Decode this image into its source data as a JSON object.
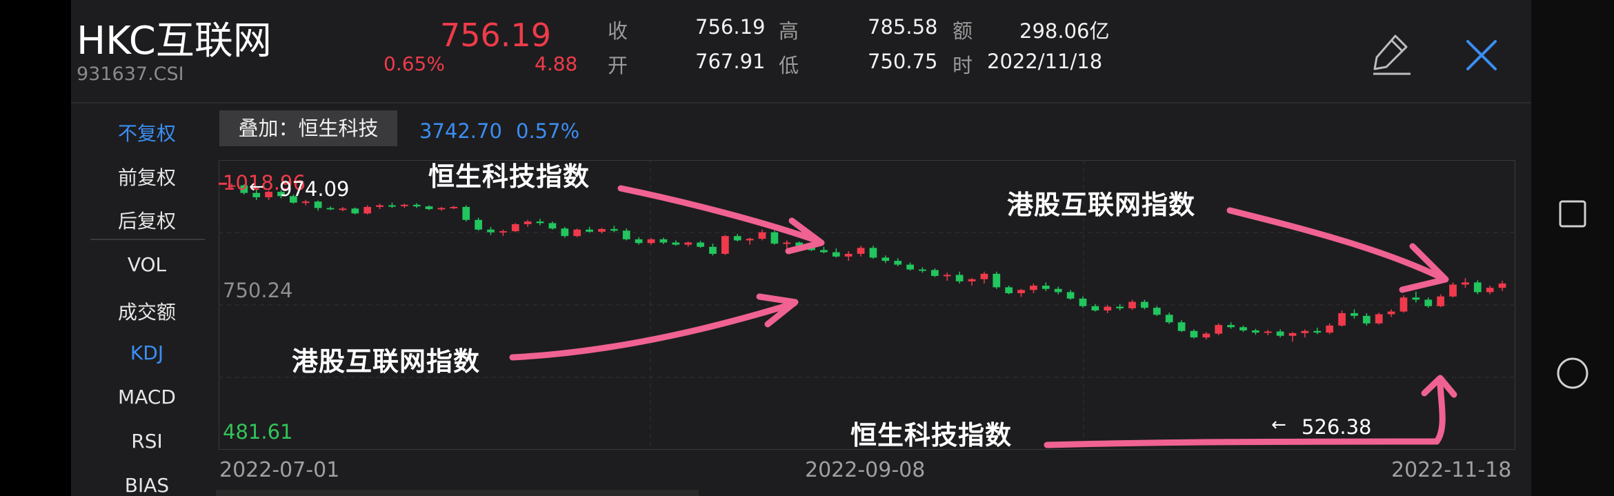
{
  "header": {
    "title": "HKC互联网",
    "code": "931637.CSI",
    "price": "756.19",
    "change_pct": "0.65%",
    "change": "4.88",
    "stats": [
      {
        "label": "收",
        "value": "756.19"
      },
      {
        "label": "开",
        "value": "767.91"
      },
      {
        "label": "高",
        "value": "785.58"
      },
      {
        "label": "低",
        "value": "750.75"
      },
      {
        "label": "额",
        "value": "298.06亿"
      },
      {
        "label": "时",
        "value": "2022/11/18"
      }
    ],
    "edit_icon": "pencil-icon",
    "close_icon": "close-icon"
  },
  "sidebar": {
    "items": [
      {
        "label": "不复权",
        "active": true
      },
      {
        "label": "前复权",
        "active": false
      },
      {
        "label": "后复权",
        "active": false
      },
      {
        "label": "VOL",
        "active": false
      },
      {
        "label": "成交额",
        "active": false
      },
      {
        "label": "KDJ",
        "active": true
      },
      {
        "label": "MACD",
        "active": false
      },
      {
        "label": "RSI",
        "active": false
      },
      {
        "label": "BIAS",
        "active": false
      }
    ]
  },
  "overlay": {
    "label": "叠加：恒生科技",
    "value": "3742.70",
    "pct": "0.57%"
  },
  "chart_data": {
    "type": "candlestick",
    "x_tick_labels": [
      "2022-07-01",
      "2022-09-08",
      "2022-11-18"
    ],
    "y_tick_labels": {
      "top": "1018.96",
      "mid": "750.24",
      "bottom": "481.61"
    },
    "ylim": [
      481.61,
      1018.96
    ],
    "annotations": {
      "high_marker": "974.09",
      "low_marker": "526.38"
    },
    "series": [
      {
        "name": "港股互联网指数",
        "color_up": "#f03a4c",
        "color_down": "#22c55e",
        "ohlc": [
          [
            970,
            975,
            965,
            972
          ],
          [
            972,
            974,
            955,
            958
          ],
          [
            958,
            965,
            945,
            950
          ],
          [
            950,
            962,
            945,
            960
          ],
          [
            960,
            963,
            948,
            952
          ],
          [
            952,
            955,
            938,
            940
          ],
          [
            940,
            945,
            935,
            942
          ],
          [
            942,
            944,
            925,
            930
          ],
          [
            930,
            933,
            926,
            928
          ],
          [
            928,
            932,
            924,
            929
          ],
          [
            929,
            931,
            918,
            920
          ],
          [
            920,
            935,
            918,
            932
          ],
          [
            932,
            938,
            928,
            935
          ],
          [
            935,
            940,
            930,
            934
          ],
          [
            934,
            938,
            930,
            936
          ],
          [
            936,
            939,
            930,
            933
          ],
          [
            933,
            935,
            926,
            928
          ],
          [
            928,
            932,
            925,
            930
          ],
          [
            930,
            934,
            928,
            932
          ],
          [
            932,
            935,
            905,
            908
          ],
          [
            908,
            912,
            888,
            890
          ],
          [
            890,
            895,
            880,
            885
          ],
          [
            885,
            890,
            878,
            887
          ],
          [
            887,
            902,
            885,
            900
          ],
          [
            900,
            908,
            895,
            905
          ],
          [
            905,
            910,
            898,
            902
          ],
          [
            902,
            905,
            890,
            892
          ],
          [
            892,
            895,
            875,
            878
          ],
          [
            878,
            892,
            876,
            890
          ],
          [
            890,
            895,
            884,
            886
          ],
          [
            886,
            893,
            883,
            891
          ],
          [
            891,
            897,
            885,
            888
          ],
          [
            888,
            892,
            870,
            872
          ],
          [
            872,
            876,
            862,
            865
          ],
          [
            865,
            874,
            862,
            872
          ],
          [
            872,
            875,
            863,
            866
          ],
          [
            866,
            870,
            860,
            862
          ],
          [
            862,
            868,
            858,
            866
          ],
          [
            866,
            869,
            856,
            858
          ],
          [
            858,
            864,
            842,
            845
          ],
          [
            845,
            880,
            843,
            878
          ],
          [
            878,
            882,
            868,
            870
          ],
          [
            870,
            875,
            862,
            873
          ],
          [
            873,
            890,
            870,
            885
          ],
          [
            885,
            888,
            862,
            864
          ],
          [
            864,
            870,
            852,
            866
          ],
          [
            866,
            868,
            855,
            860
          ],
          [
            860,
            862,
            850,
            852
          ],
          [
            852,
            858,
            846,
            848
          ],
          [
            848,
            855,
            838,
            840
          ],
          [
            840,
            850,
            832,
            845
          ],
          [
            845,
            860,
            840,
            856
          ],
          [
            856,
            860,
            836,
            838
          ],
          [
            838,
            842,
            828,
            832
          ],
          [
            832,
            837,
            822,
            825
          ],
          [
            825,
            829,
            814,
            816
          ],
          [
            816,
            820,
            810,
            815
          ],
          [
            815,
            818,
            802,
            804
          ],
          [
            804,
            810,
            795,
            806
          ],
          [
            806,
            812,
            790,
            794
          ],
          [
            794,
            800,
            786,
            798
          ],
          [
            798,
            812,
            790,
            808
          ],
          [
            808,
            812,
            780,
            783
          ],
          [
            783,
            786,
            770,
            772
          ],
          [
            772,
            780,
            765,
            778
          ],
          [
            778,
            790,
            772,
            786
          ],
          [
            786,
            792,
            776,
            780
          ],
          [
            780,
            784,
            770,
            774
          ],
          [
            774,
            778,
            760,
            762
          ],
          [
            762,
            766,
            745,
            748
          ],
          [
            748,
            752,
            738,
            740
          ],
          [
            740,
            750,
            735,
            747
          ],
          [
            747,
            752,
            740,
            744
          ],
          [
            744,
            760,
            741,
            756
          ],
          [
            756,
            760,
            742,
            745
          ],
          [
            745,
            748,
            730,
            732
          ],
          [
            732,
            736,
            715,
            718
          ],
          [
            718,
            722,
            700,
            702
          ],
          [
            702,
            705,
            688,
            690
          ],
          [
            690,
            700,
            686,
            697
          ],
          [
            697,
            716,
            694,
            713
          ],
          [
            713,
            718,
            706,
            709
          ],
          [
            709,
            712,
            700,
            703
          ],
          [
            703,
            706,
            695,
            699
          ],
          [
            699,
            704,
            694,
            701
          ],
          [
            701,
            705,
            690,
            693
          ],
          [
            693,
            700,
            682,
            698
          ],
          [
            698,
            705,
            690,
            702
          ],
          [
            702,
            708,
            696,
            699
          ],
          [
            699,
            716,
            696,
            712
          ],
          [
            712,
            740,
            710,
            735
          ],
          [
            735,
            742,
            725,
            730
          ],
          [
            730,
            735,
            712,
            716
          ],
          [
            716,
            736,
            714,
            733
          ],
          [
            733,
            742,
            728,
            738
          ],
          [
            738,
            768,
            736,
            764
          ],
          [
            764,
            775,
            755,
            760
          ],
          [
            760,
            764,
            745,
            748
          ],
          [
            748,
            770,
            746,
            766
          ],
          [
            766,
            792,
            764,
            788
          ],
          [
            788,
            800,
            782,
            792
          ],
          [
            792,
            796,
            770,
            774
          ],
          [
            774,
            786,
            770,
            782
          ],
          [
            782,
            795,
            776,
            790
          ]
        ]
      }
    ]
  },
  "annotations_text": {
    "hs_tech_top": "恒生科技指数",
    "hk_internet_left": "港股互联网指数",
    "hk_internet_right": "港股互联网指数",
    "hs_tech_bottom": "恒生科技指数"
  },
  "system_nav": {
    "recents_icon": "square-recents-icon",
    "home_icon": "circle-home-icon"
  }
}
